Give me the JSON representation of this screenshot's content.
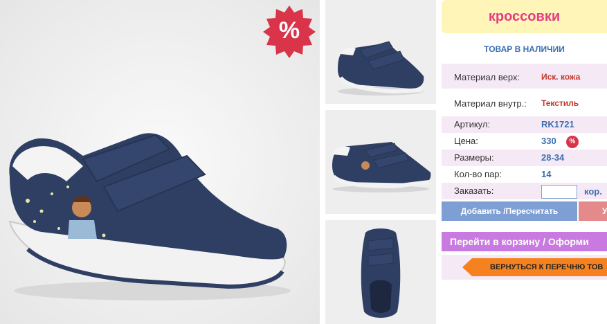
{
  "badge": {
    "sale_symbol": "%"
  },
  "product": {
    "title": "кроссовки",
    "stock_status": "ТОВАР В НАЛИЧИИ",
    "details": [
      {
        "label": "Материал верх:",
        "value": "Иск. кожа"
      },
      {
        "label": "Материал внутр.:",
        "value": "Текстиль"
      },
      {
        "label": "Артикул:",
        "value": "RK1721"
      },
      {
        "label": "Цена:",
        "value": "330"
      },
      {
        "label": "Размеры:",
        "value": "28-34"
      },
      {
        "label": "Кол-во пар:",
        "value": "14"
      },
      {
        "label": "Заказать:",
        "value": ""
      }
    ],
    "price_sale_mark": "%",
    "order_unit": "кор.",
    "order_quantity": ""
  },
  "actions": {
    "add_label": "Добавить /Пересчитать",
    "remove_label": "У",
    "cart_label": "Перейти в корзину / Оформи",
    "back_label": "ВЕРНУТЬСЯ К ПЕРЕЧНЮ ТОВ"
  },
  "colors": {
    "shoe_navy": "#2f3f63",
    "sole_white": "#f2f2f2",
    "title_pink": "#e33d85",
    "link_blue": "#3a6fb0",
    "badge_red": "#d9344a",
    "orange": "#f5821f",
    "purple": "#c97ae0"
  }
}
